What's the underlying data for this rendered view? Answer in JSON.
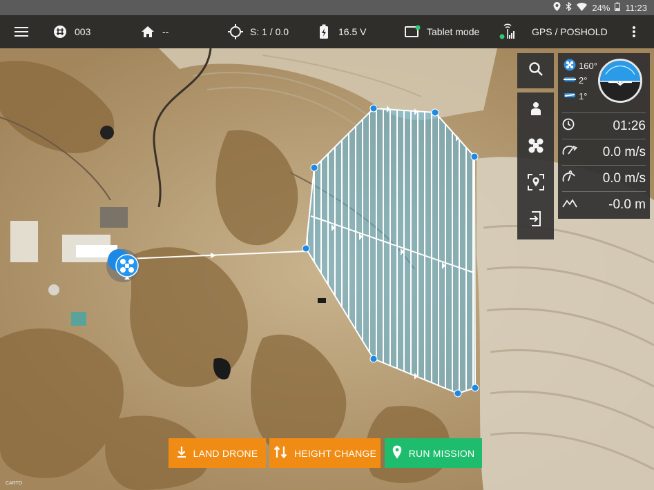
{
  "status_bar": {
    "battery_percent": "24%",
    "time": "11:23",
    "icons": [
      "location-icon",
      "bluetooth-icon",
      "wifi-icon",
      "battery-icon"
    ]
  },
  "toolbar": {
    "menu_icon": "hamburger-menu-icon",
    "drone_id": "003",
    "home_value": "--",
    "satellites": "S: 1 / 0.0",
    "voltage": "16.5 V",
    "tablet_mode": "Tablet mode",
    "gps_mode": "GPS / POSHOLD",
    "overflow_icon": "more-vertical-icon"
  },
  "attitude": {
    "heading": "160°",
    "pitch": "2°",
    "roll": "1°"
  },
  "telemetry": {
    "flight_time": "01:26",
    "horizontal_speed": "0.0 m/s",
    "vertical_speed": "0.0 m/s",
    "altitude": "-0.0 m"
  },
  "right_controls": [
    "search-icon",
    "follow-me-icon",
    "drone-center-icon",
    "fit-map-icon",
    "exit-mission-icon"
  ],
  "actions": {
    "land": "LAND DRONE",
    "height": "HEIGHT CHANGE",
    "run": "RUN MISSION"
  },
  "colors": {
    "accent_orange": "#f08c14",
    "accent_green": "#1ebd6e",
    "mission_fill": "#5fb6dd",
    "waypoint": "#1e88e5"
  }
}
